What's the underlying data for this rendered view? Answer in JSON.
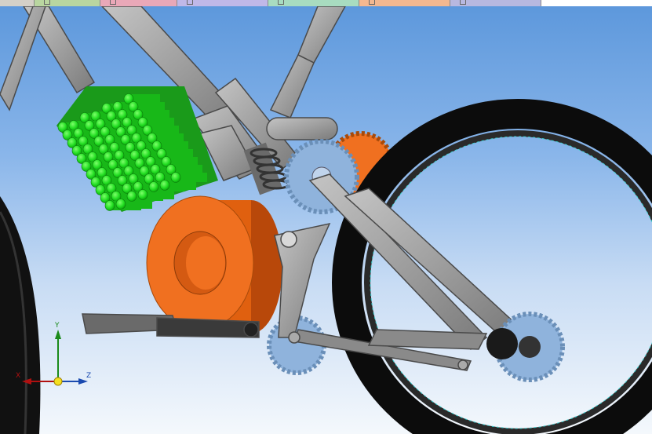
{
  "tabs": [
    {
      "name": "tab-1",
      "label": "",
      "color": "#b9d6a0",
      "icon": "document-icon"
    },
    {
      "name": "tab-2",
      "label": "",
      "color": "#e9a8b8",
      "icon": "document-icon"
    },
    {
      "name": "tab-3",
      "label": "",
      "color": "#c0b8e8",
      "icon": "document-icon"
    },
    {
      "name": "tab-4",
      "label": "",
      "color": "#a8dcc0",
      "icon": "document-icon"
    },
    {
      "name": "tab-5",
      "label": "",
      "color": "#f4b890",
      "icon": "document-icon"
    },
    {
      "name": "tab-6",
      "label": "",
      "color": "#b8b8e0",
      "icon": "document-icon"
    },
    {
      "name": "tab-7",
      "label": "",
      "color": "#ffffff",
      "icon": ""
    }
  ],
  "triad": {
    "x_label": "X",
    "y_label": "Y",
    "z_label": "Z",
    "x_color": "#b01010",
    "y_color": "#1a8a1a",
    "z_color": "#1a4ab0"
  },
  "scene": {
    "frame_color": "#9c9c9c",
    "battery_color": "#22dd22",
    "motor_color": "#f07020",
    "sprocket_color": "#8fb3dc",
    "tire_color": "#111111"
  }
}
